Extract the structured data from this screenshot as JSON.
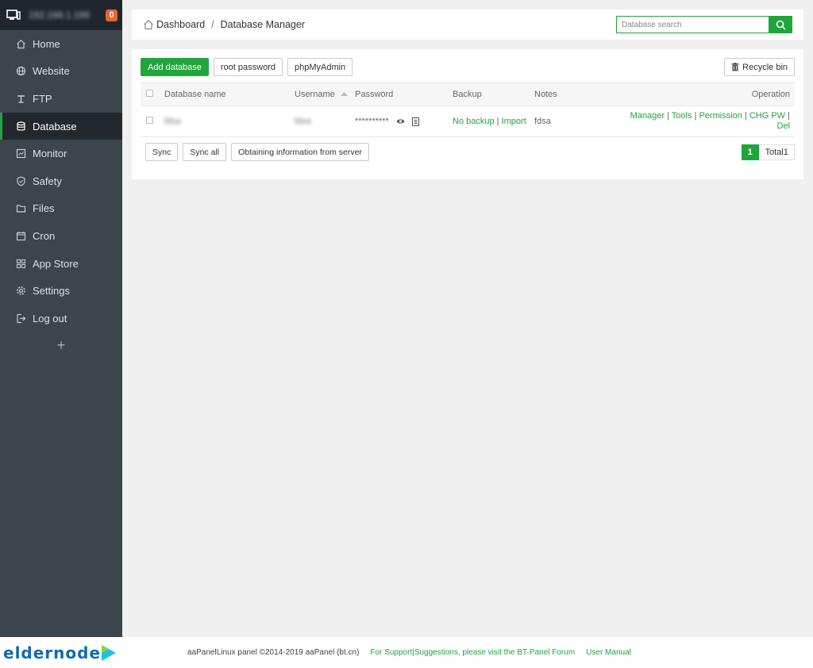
{
  "sidebar": {
    "host_ip": "192.168.1.199",
    "notification_count": "0",
    "items": [
      {
        "label": "Home",
        "icon": "home-icon"
      },
      {
        "label": "Website",
        "icon": "globe-icon"
      },
      {
        "label": "FTP",
        "icon": "ftp-icon"
      },
      {
        "label": "Database",
        "icon": "database-icon",
        "active": true
      },
      {
        "label": "Monitor",
        "icon": "monitor-icon"
      },
      {
        "label": "Safety",
        "icon": "shield-icon"
      },
      {
        "label": "Files",
        "icon": "folder-icon"
      },
      {
        "label": "Cron",
        "icon": "calendar-icon"
      },
      {
        "label": "App Store",
        "icon": "grid-icon"
      },
      {
        "label": "Settings",
        "icon": "gear-icon"
      },
      {
        "label": "Log out",
        "icon": "logout-icon"
      }
    ],
    "add_symbol": "+"
  },
  "header": {
    "breadcrumb_home": "Dashboard",
    "breadcrumb_separator": "/",
    "breadcrumb_current": "Database Manager",
    "search_placeholder": "Database search"
  },
  "toolbar": {
    "add_database": "Add database",
    "root_password": "root password",
    "phpmyadmin": "phpMyAdmin",
    "recycle_bin": "Recycle bin"
  },
  "table": {
    "columns": [
      "Database name",
      "Username",
      "Password",
      "Backup",
      "Notes",
      "Operation"
    ],
    "rows": [
      {
        "name": "fdsa",
        "username": "fdsa",
        "password": "**********",
        "backup_status": "No backup",
        "backup_sep": "|",
        "backup_import": "Import",
        "notes": "fdsa",
        "ops": {
          "manager": "Manager",
          "tools": "Tools",
          "permission": "Permission",
          "chg_pw": "CHG PW",
          "del": "Del",
          "sep": "|"
        }
      }
    ]
  },
  "actions": {
    "sync": "Sync",
    "sync_all": "Sync all",
    "obtain": "Obtaining information from server"
  },
  "pagination": {
    "current": "1",
    "total": "Total1"
  },
  "footer": {
    "copyright": "aaPanelLinux panel ©2014-2019 aaPanel (bt.cn)",
    "support": "For Support|Suggestions, please visit the BT-Panel Forum",
    "manual": "User Manual"
  },
  "logo": {
    "text": "eldernode"
  },
  "colors": {
    "accent": "#20a53a",
    "sidebar_bg": "#3c444d",
    "sidebar_top": "#20262d",
    "badge": "#f0622e"
  }
}
